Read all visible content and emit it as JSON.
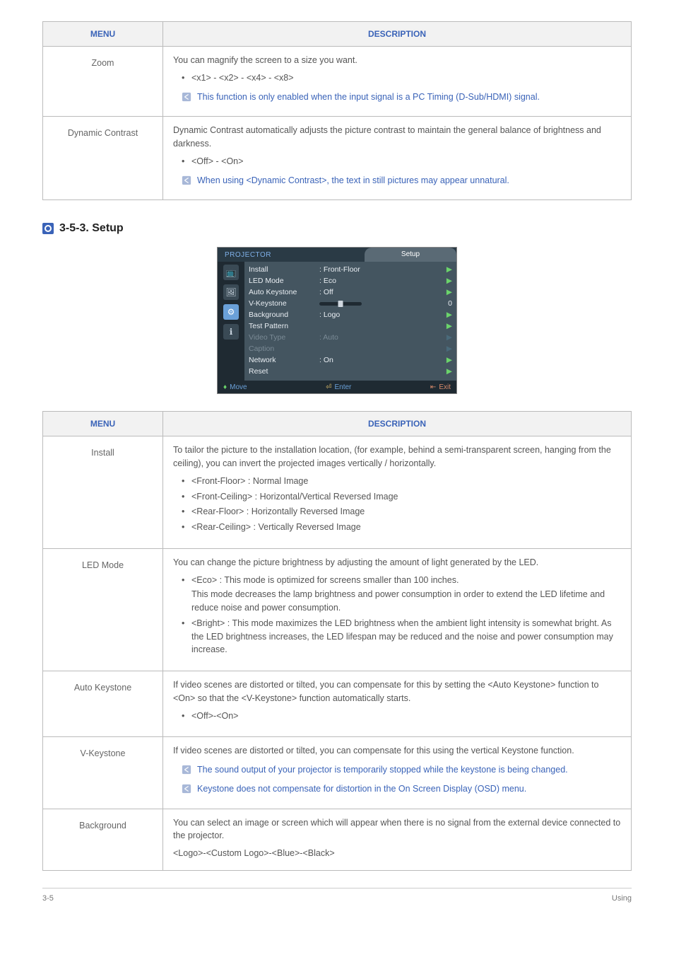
{
  "table1": {
    "headers": {
      "menu": "MENU",
      "description": "DESCRIPTION"
    },
    "rows": [
      {
        "menu": "Zoom",
        "intro": "You can magnify the screen to a size you want.",
        "bullet1": "<x1> - <x2> - <x4> - <x8>",
        "note1": "This function is only enabled when the input signal is a PC Timing (D-Sub/HDMI) signal."
      },
      {
        "menu": "Dynamic Contrast",
        "intro": "Dynamic Contrast automatically adjusts the picture contrast to maintain the general balance of brightness and darkness.",
        "bullet1": "<Off> - <On>",
        "note1": "When using <Dynamic Contrast>, the text in still pictures may appear unnatural."
      }
    ]
  },
  "section": {
    "title": "3-5-3. Setup"
  },
  "osd": {
    "projector": "PROJECTOR",
    "tab": "Setup",
    "rows": {
      "install": {
        "lbl": "Install",
        "val": ": Front-Floor"
      },
      "ledmode": {
        "lbl": "LED Mode",
        "val": ": Eco"
      },
      "autokey": {
        "lbl": "Auto Keystone",
        "val": ": Off"
      },
      "vkey": {
        "lbl": "V-Keystone",
        "num": "0"
      },
      "bg": {
        "lbl": "Background",
        "val": ": Logo"
      },
      "testpat": {
        "lbl": "Test Pattern",
        "val": ""
      },
      "videotype": {
        "lbl": "Video Type",
        "val": ": Auto"
      },
      "caption": {
        "lbl": "Caption",
        "val": ""
      },
      "network": {
        "lbl": "Network",
        "val": ": On"
      },
      "reset": {
        "lbl": "Reset",
        "val": ""
      }
    },
    "foot": {
      "move": "Move",
      "enter": "Enter",
      "exit": "Exit"
    }
  },
  "table2": {
    "headers": {
      "menu": "MENU",
      "description": "DESCRIPTION"
    },
    "rows": {
      "install": {
        "menu": "Install",
        "intro": "To tailor the picture to the installation location, (for example, behind a semi-transparent screen, hanging from the ceiling), you can invert the projected images vertically / horizontally.",
        "b1": "<Front-Floor> : Normal Image",
        "b2": "<Front-Ceiling> : Horizontal/Vertical Reversed Image",
        "b3": "<Rear-Floor> : Horizontally Reversed Image",
        "b4": "<Rear-Ceiling> : Vertically Reversed Image"
      },
      "ledmode": {
        "menu": "LED Mode",
        "intro": "You can change the picture brightness by adjusting the amount of light generated by the LED.",
        "b1a": "<Eco> : This mode is optimized for screens smaller than 100 inches.",
        "b1b": "This mode decreases the lamp brightness and power consumption in order to extend the LED lifetime and reduce noise and power consumption.",
        "b2": "<Bright> : This mode maximizes the LED brightness when the ambient light intensity is somewhat bright. As the LED brightness increases, the LED lifespan may be reduced and the noise and power consumption may increase."
      },
      "autokey": {
        "menu": "Auto Keystone",
        "intro": "If video scenes are distorted or tilted, you can compensate for this by setting the <Auto Keystone> function to <On> so that the <V-Keystone> function automatically starts.",
        "b1": "<Off>-<On>"
      },
      "vkey": {
        "menu": "V-Keystone",
        "intro": "If video scenes are distorted or tilted, you can compensate for this using the vertical Keystone function.",
        "note1": "The sound output of your projector is temporarily stopped while the keystone is being changed.",
        "note2": "Keystone does not compensate for distortion in the On Screen Display (OSD) menu."
      },
      "bg": {
        "menu": "Background",
        "intro": "You can select an image or screen which will appear when there is no signal from the external device connected to the projector.",
        "line2": "<Logo>-<Custom Logo>-<Blue>-<Black>"
      }
    }
  },
  "footer": {
    "left": "3-5",
    "right": "Using"
  }
}
